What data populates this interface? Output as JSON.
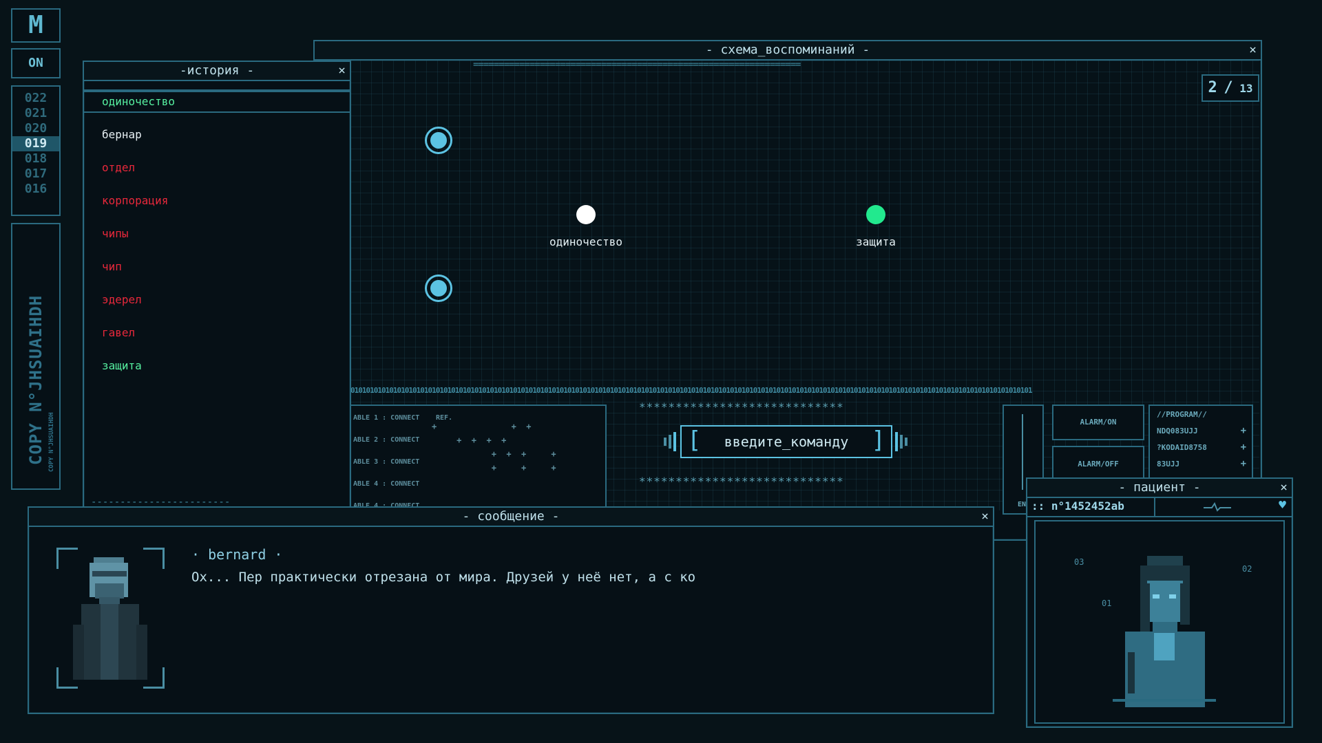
{
  "side_strip": {
    "m_label": "M",
    "status_label": "ON",
    "numbers": [
      "022",
      "021",
      "020",
      "019",
      "018",
      "017",
      "016"
    ],
    "selected_number": "019",
    "copy_label": "COPY N°JHSUAIHDH",
    "copy_small_label": "COPY N°JHSUAIHDH"
  },
  "history_window": {
    "title": "-история -",
    "close": "×",
    "items": [
      {
        "label": "одиночество",
        "color": "#56f0a0"
      },
      {
        "label": "бернар",
        "color": "#e6eef2"
      },
      {
        "label": "отдел",
        "color": "#e8283b"
      },
      {
        "label": "корпорация",
        "color": "#e8283b"
      },
      {
        "label": "чипы",
        "color": "#e8283b"
      },
      {
        "label": "чип",
        "color": "#e8283b"
      },
      {
        "label": "эдерел",
        "color": "#e8283b"
      },
      {
        "label": "гавел",
        "color": "#e8283b"
      },
      {
        "label": "защита",
        "color": "#56f0a0"
      }
    ],
    "footer_dashes": "------------------------"
  },
  "memory_window": {
    "title": "- схема_воспоминаний -",
    "close": "×",
    "header_rule": "================================================================",
    "page_current": "2",
    "page_sep": "/",
    "page_total": "13",
    "nodes": [
      {
        "label": "одиночество",
        "color": "#ffffff"
      },
      {
        "label": "защита",
        "color": "#22e98e"
      }
    ],
    "binary_strip": "01010101010101010101010101010101010101010101010101010101010101010101010101010101010101010101010101010101010101010101010101010101010101010101010101010101010101010101010101010101"
  },
  "cable_panel": {
    "rows": [
      "ABLE 1 : CONNECT",
      "ABLE 2 : CONNECT",
      "ABLE 3 : CONNECT",
      "ABLE 4 : CONNECT",
      "ABLE 4 : CONNECT"
    ],
    "ref_label": "REF."
  },
  "command": {
    "label": "введите_команду",
    "left_bracket": "[",
    "right_bracket": "]",
    "stars": "****************************"
  },
  "alarm_panel": {
    "alarm_on": "ALARM/ON",
    "alarm_off": "ALARM/OFF",
    "program_title": "//PROGRAM//",
    "programs": [
      "NDQ083UJJ",
      "?KODAID8758",
      "83UJJ"
    ],
    "cut_label": "EN"
  },
  "message_window": {
    "title": "- сообщение -",
    "close": "×",
    "speaker": "· bernard ·",
    "text": "Ох... Пер практически отрезана от мира. Друзей у неё нет, а с ко"
  },
  "patient_window": {
    "title": "- пациент -",
    "close": "×",
    "patient_id": ":: n°1452452ab",
    "marks": [
      "03",
      "02",
      "01"
    ]
  },
  "colors": {
    "accent": "#5cc3e3",
    "border": "#2a6a80",
    "background": "#071318",
    "red_item": "#e8283b",
    "green_item": "#56f0a0"
  }
}
